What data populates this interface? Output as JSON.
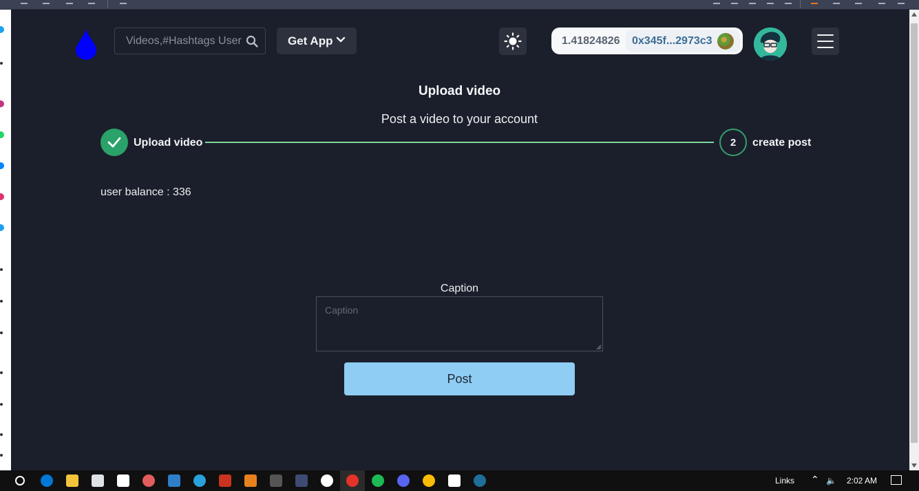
{
  "header": {
    "search_placeholder": "Videos,#Hashtags User",
    "get_app_label": "Get App",
    "wallet_balance": "1.41824826",
    "wallet_address": "0x345f...2973c3"
  },
  "main": {
    "title": "Upload video",
    "subtitle": "Post a video to your account",
    "steps": [
      {
        "label": "Upload video",
        "status": "complete"
      },
      {
        "number": "2",
        "label": "create post",
        "status": "current"
      }
    ],
    "user_balance": "user balance : 336",
    "caption_label": "Caption",
    "caption_placeholder": "Caption",
    "caption_value": "",
    "post_label": "Post"
  },
  "taskbar": {
    "links_label": "Links",
    "time": "2:02 AM"
  },
  "colors": {
    "background": "#1b1f2b",
    "step_complete": "#2aa269",
    "step_line": "#7fd99f",
    "post_button": "#8fcdf4",
    "logo_drop": "#0000ff"
  }
}
